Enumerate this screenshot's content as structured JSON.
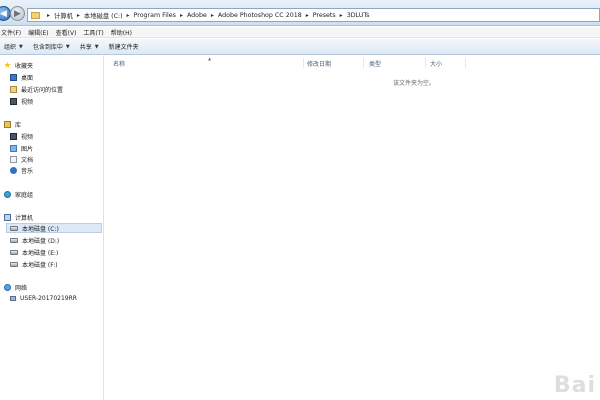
{
  "address_bar": {
    "crumbs": [
      "计算机",
      "本地磁盘 (C:)",
      "Program Files",
      "Adobe",
      "Adobe Photoshop CC 2018",
      "Presets",
      "3DLUTs"
    ]
  },
  "menu": {
    "items": [
      "文件(F)",
      "编辑(E)",
      "查看(V)",
      "工具(T)",
      "帮助(H)"
    ]
  },
  "toolbar": {
    "organize": "组织",
    "include_library": "包含到库中",
    "share": "共享",
    "new_folder": "新建文件夹"
  },
  "nav": {
    "favorites": "收藏夹",
    "desktop": "桌面",
    "recent": "最近访问的位置",
    "videos_fav": "视频",
    "libraries": "库",
    "videos": "视频",
    "pictures": "图片",
    "documents": "文档",
    "music": "音乐",
    "homegroup": "家庭组",
    "computer": "计算机",
    "drive_c": "本地磁盘 (C:)",
    "drive_d": "本地磁盘 (D:)",
    "drive_e": "本地磁盘 (E:)",
    "drive_f": "本地磁盘 (F:)",
    "network": "网络",
    "network_pc": "USER-20170219RR"
  },
  "columns": {
    "name": "名称",
    "date_modified": "修改日期",
    "type": "类型",
    "size": "大小"
  },
  "content": {
    "empty_message": "该文件夹为空。"
  },
  "watermark": "Bai"
}
